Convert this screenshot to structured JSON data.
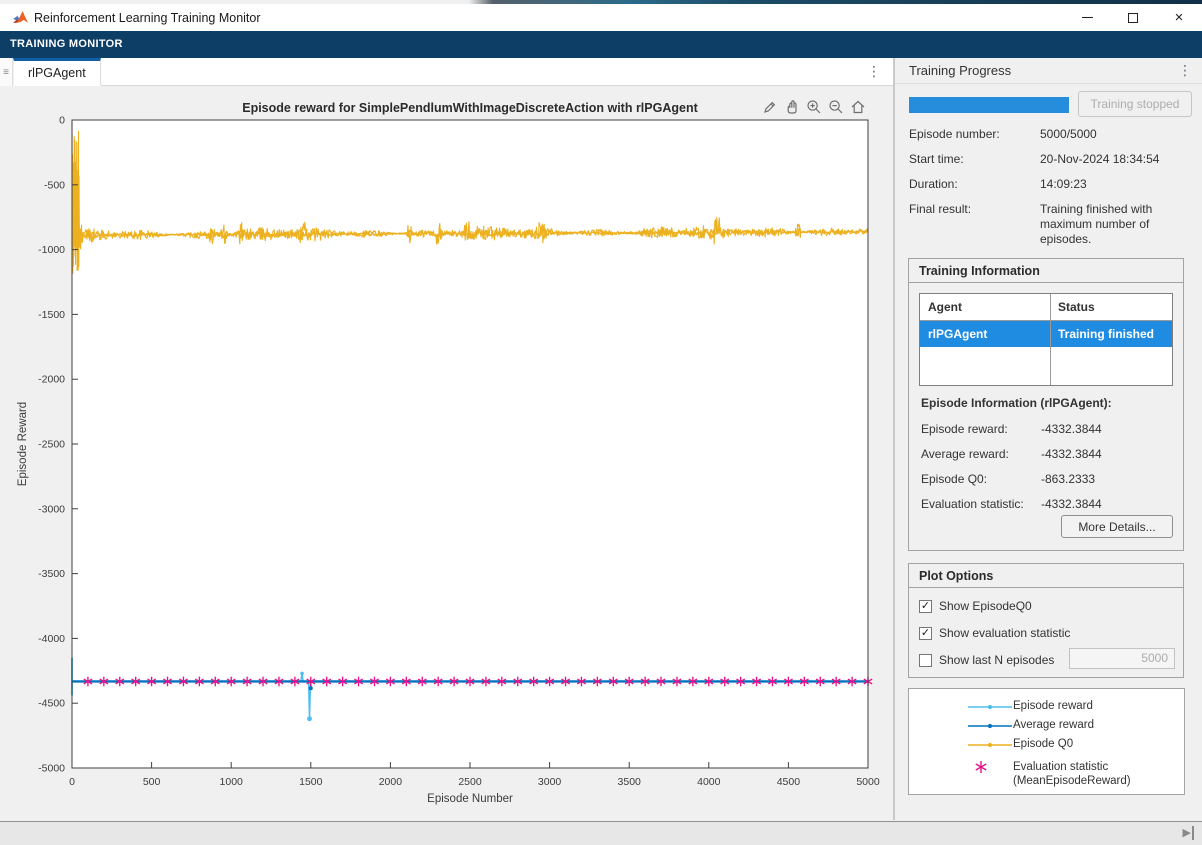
{
  "window": {
    "title": "Reinforcement Learning Training Monitor",
    "close_glyph": "×"
  },
  "icons": {
    "grip": "≡",
    "kebab": "⋮",
    "scroll_end": "▶",
    "check": "✓"
  },
  "ribbon": {
    "label": "TRAINING MONITOR"
  },
  "tabs": {
    "active": "rlPGAgent"
  },
  "colors": {
    "accent_blue": "#268cdc",
    "selection_blue": "#1f8ce2",
    "ribbon_navy": "#0d3e66",
    "episode_reward": "#4DBEEE",
    "average_reward": "#0072BD",
    "episode_q0": "#EDB120",
    "evaluation_statistic": "#e5148c"
  },
  "chart_data": {
    "type": "line",
    "title": "Episode reward for SimplePendlumWithImageDiscreteAction with rlPGAgent",
    "xlabel": "Episode Number",
    "ylabel": "Episode Reward",
    "xlim": [
      0,
      5000
    ],
    "ylim": [
      -5000,
      0
    ],
    "xticks": [
      0,
      500,
      1000,
      1500,
      2000,
      2500,
      3000,
      3500,
      4000,
      4500,
      5000
    ],
    "yticks": [
      0,
      -500,
      -1000,
      -1500,
      -2000,
      -2500,
      -3000,
      -3500,
      -4000,
      -4500,
      -5000
    ],
    "grid": false,
    "series": [
      {
        "name": "Episode reward",
        "color": "#4DBEEE",
        "baseline": -4332.3844,
        "anomalies": [
          {
            "x": 0,
            "ymin": -4440,
            "ymax": -4150
          },
          {
            "x": 1445,
            "y": -4270
          },
          {
            "x": 1492,
            "y": -4620
          }
        ]
      },
      {
        "name": "Average reward",
        "color": "#0072BD",
        "baseline": -4332.3844,
        "anomalies": [
          {
            "x": 1500,
            "y": -4385
          }
        ]
      },
      {
        "name": "Episode Q0",
        "color": "#EDB120",
        "initial_transient": {
          "x_range": [
            0,
            45
          ],
          "y_range": [
            -1210,
            0
          ]
        },
        "band_mean_start": -888,
        "band_mean_end": -862,
        "band_noise": 45,
        "spikes_x": [
          880,
          955,
          1060,
          1445,
          2120,
          2300,
          2480,
          2950,
          4050,
          4560
        ]
      },
      {
        "name": "Evaluation statistic (MeanEpisodeReward)",
        "color": "#e5148c",
        "marker": "*",
        "x_start": 100,
        "x_step": 100,
        "x_end": 5000,
        "y": -4332.3844
      }
    ],
    "legend": [
      {
        "label": "Episode reward",
        "label2": "",
        "color": "#4DBEEE",
        "marker": "line-dot"
      },
      {
        "label": "Average reward",
        "label2": "",
        "color": "#0072BD",
        "marker": "line-dot"
      },
      {
        "label": "Episode Q0",
        "label2": "",
        "color": "#EDB120",
        "marker": "line-dot"
      },
      {
        "label": "Evaluation statistic",
        "label2": "(MeanEpisodeReward)",
        "color": "#e5148c",
        "marker": "asterisk"
      }
    ],
    "toolbar": [
      "edit-plot",
      "pan",
      "zoom-in",
      "zoom-out",
      "restore-view"
    ]
  },
  "progress": {
    "header": "Training Progress",
    "stop_button": "Training stopped",
    "percent": 100,
    "rows": [
      {
        "label": "Episode number:",
        "value": "5000/5000"
      },
      {
        "label": "Start time:",
        "value": "20-Nov-2024 18:34:54"
      },
      {
        "label": "Duration:",
        "value": "14:09:23"
      },
      {
        "label": "Final result:",
        "value": "Training finished with maximum number of episodes."
      }
    ]
  },
  "training_info": {
    "title": "Training Information",
    "table": {
      "headers": [
        "Agent",
        "Status"
      ],
      "rows": [
        {
          "agent": "rlPGAgent",
          "status": "Training finished",
          "selected": true
        }
      ]
    },
    "episode_info_title": "Episode Information (rlPGAgent):",
    "rows": [
      {
        "label": "Episode reward:",
        "value": "-4332.3844"
      },
      {
        "label": "Average reward:",
        "value": "-4332.3844"
      },
      {
        "label": "Episode Q0:",
        "value": "-863.2333"
      },
      {
        "label": "Evaluation statistic:",
        "value": "-4332.3844"
      }
    ],
    "more_details": "More Details..."
  },
  "plot_options": {
    "title": "Plot Options",
    "checkboxes": [
      {
        "label": "Show EpisodeQ0",
        "checked": true
      },
      {
        "label": "Show evaluation statistic",
        "checked": true
      },
      {
        "label": "Show last N episodes",
        "checked": false
      }
    ],
    "n_episodes_value": "5000"
  }
}
